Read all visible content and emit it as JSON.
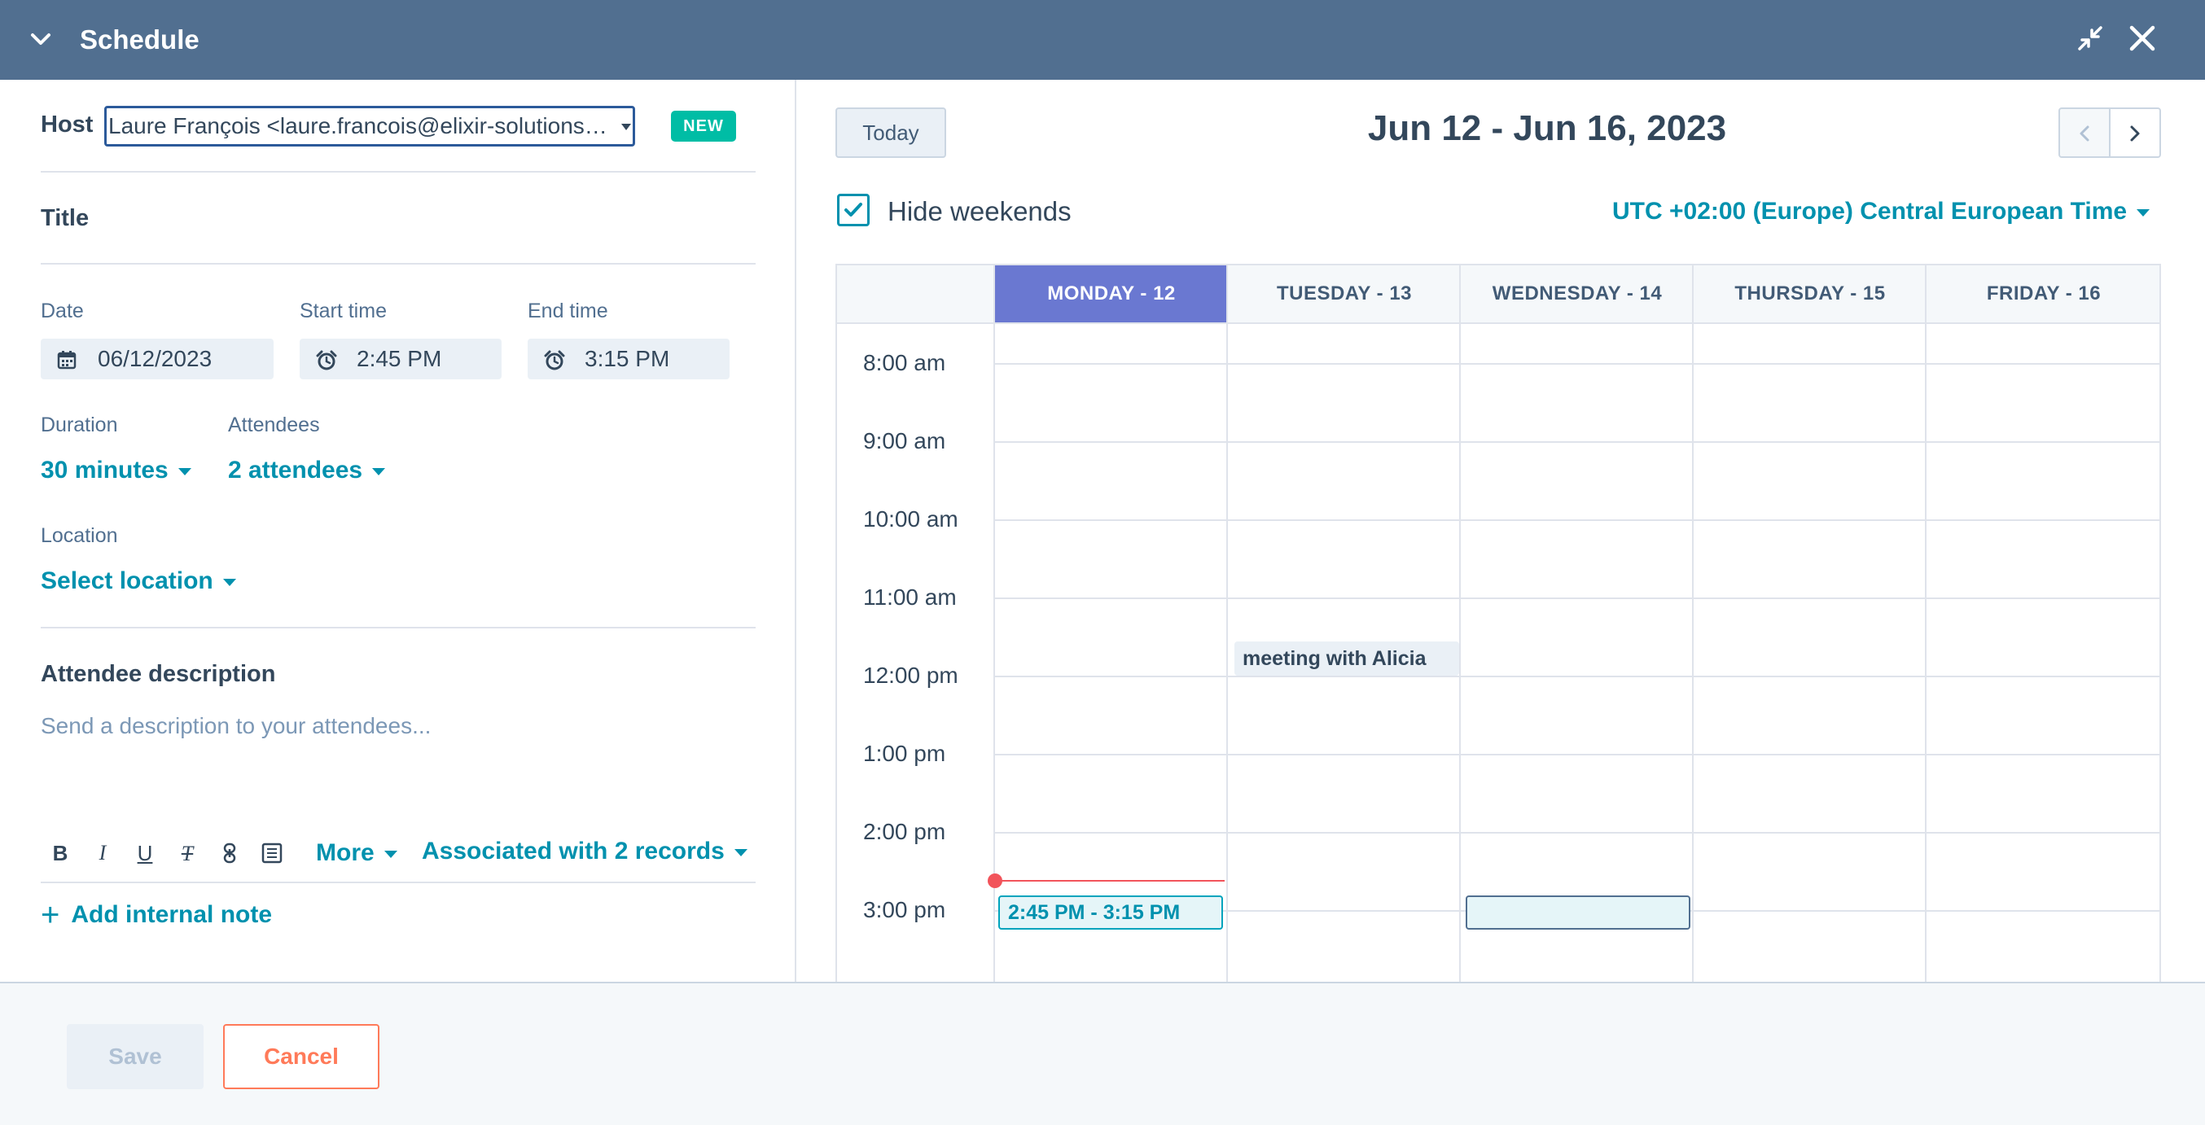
{
  "header": {
    "title": "Schedule"
  },
  "form": {
    "host_label": "Host",
    "host_value": "Laure François <laure.francois@elixir-solutions…",
    "new_badge": "NEW",
    "title_label": "Title",
    "date_label": "Date",
    "date_value": "06/12/2023",
    "start_label": "Start time",
    "start_value": "2:45 PM",
    "end_label": "End time",
    "end_value": "3:15 PM",
    "duration_label": "Duration",
    "duration_value": "30 minutes",
    "attendees_label": "Attendees",
    "attendees_value": "2 attendees",
    "location_label": "Location",
    "location_value": "Select location",
    "description_label": "Attendee description",
    "description_placeholder": "Send a description to your attendees...",
    "toolbar": {
      "bold": "B",
      "italic": "I",
      "underline": "U",
      "clear": "T",
      "more": "More",
      "associated": "Associated with 2 records"
    },
    "add_note": "Add internal note"
  },
  "calendar": {
    "today_label": "Today",
    "range_title": "Jun 12 - Jun 16, 2023",
    "hide_weekends_label": "Hide weekends",
    "hide_weekends_checked": true,
    "timezone": "UTC +02:00 (Europe) Central European Time",
    "days": [
      "MONDAY - 12",
      "TUESDAY - 13",
      "WEDNESDAY - 14",
      "THURSDAY - 15",
      "FRIDAY - 16"
    ],
    "active_day_index": 0,
    "times": [
      "8:00 am",
      "9:00 am",
      "10:00 am",
      "11:00 am",
      "12:00 pm",
      "1:00 pm",
      "2:00 pm",
      "3:00 pm"
    ],
    "events": {
      "existing": "meeting with Alicia",
      "new": "2:45 PM - 3:15 PM"
    }
  },
  "footer": {
    "save": "Save",
    "cancel": "Cancel"
  },
  "colors": {
    "header": "#516f90",
    "accent": "#0091ae",
    "active_day": "#6a78d1",
    "now_line": "#f2545b",
    "cancel": "#ff7a59"
  }
}
